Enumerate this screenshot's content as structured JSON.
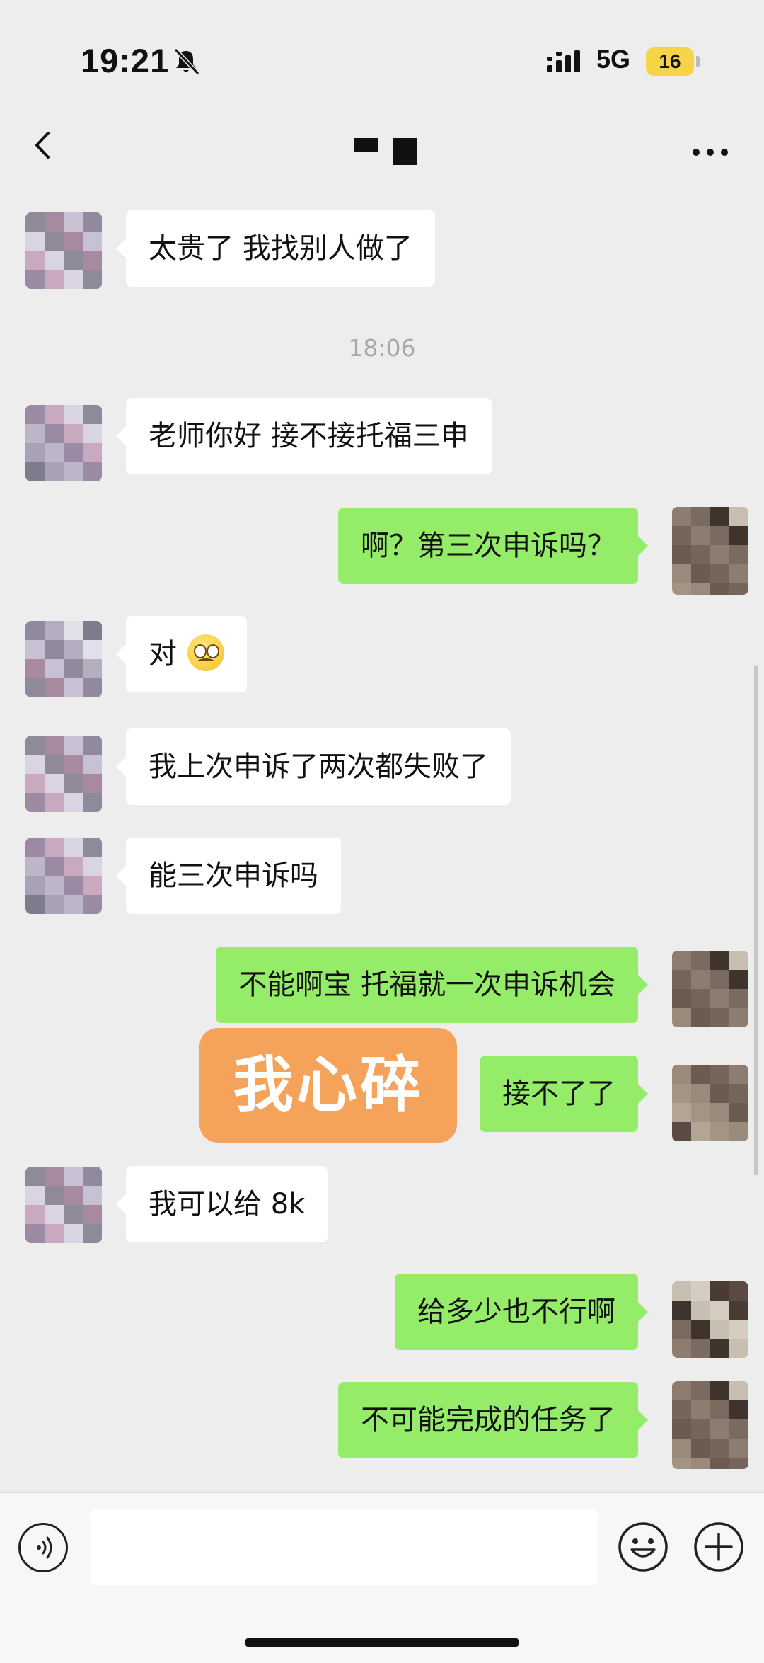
{
  "status_bar": {
    "time": "19:21",
    "network": "5G",
    "battery": "16"
  },
  "chat": {
    "timestamp": "18:06",
    "messages": [
      {
        "side": "other",
        "text": "太贵了 我找别人做了"
      },
      {
        "side": "other",
        "text": "老师你好 接不接托福三申"
      },
      {
        "side": "self",
        "text": "啊？第三次申诉吗？"
      },
      {
        "side": "other",
        "text": "对"
      },
      {
        "side": "other",
        "text": "我上次申诉了两次都失败了"
      },
      {
        "side": "other",
        "text": "能三次申诉吗"
      },
      {
        "side": "self",
        "text": "不能啊宝 托福就一次申诉机会"
      },
      {
        "side": "self",
        "text": "接不了了"
      },
      {
        "side": "other",
        "text": "我可以给 8k"
      },
      {
        "side": "self",
        "text": "给多少也不行啊"
      },
      {
        "side": "self",
        "text": "不可能完成的任务了"
      }
    ],
    "sticker_text": "我心碎"
  },
  "colors": {
    "self_bubble": "#95ec69",
    "other_bubble": "#ffffff",
    "sticker_bg": "#f5a35a",
    "background": "#ededed"
  },
  "icons": [
    "back-icon",
    "more-icon",
    "voice-icon",
    "emoji-icon",
    "plus-icon",
    "mute-icon",
    "signal-icon"
  ]
}
